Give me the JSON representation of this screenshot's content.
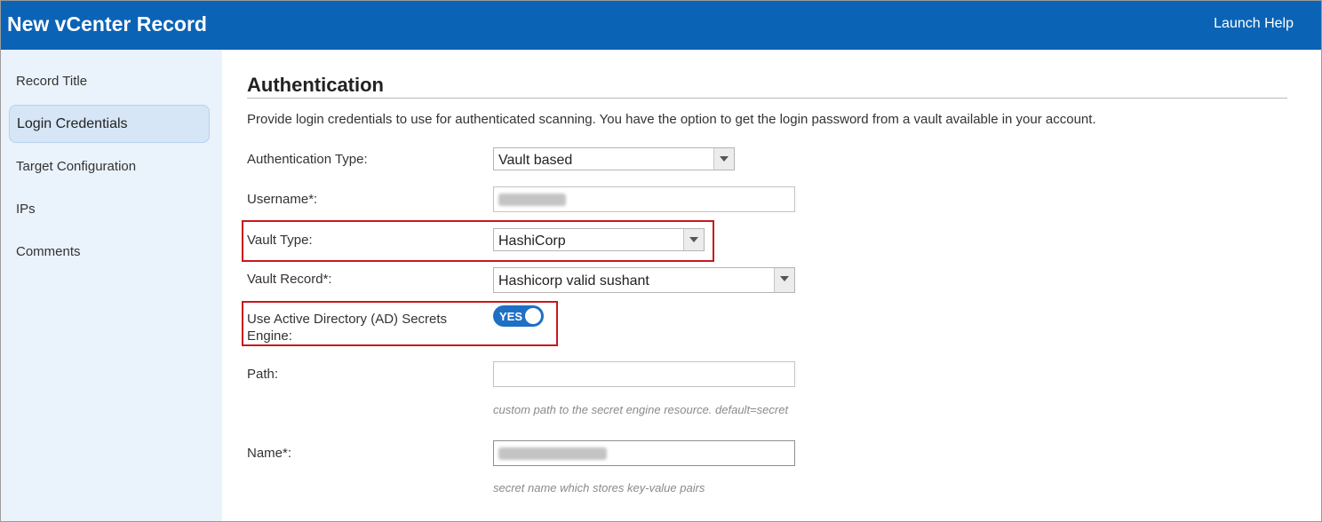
{
  "header": {
    "title": "New vCenter Record",
    "help_label": "Launch Help"
  },
  "sidebar": {
    "items": [
      {
        "label": "Record Title",
        "active": false
      },
      {
        "label": "Login Credentials",
        "active": true
      },
      {
        "label": "Target Configuration",
        "active": false
      },
      {
        "label": "IPs",
        "active": false
      },
      {
        "label": "Comments",
        "active": false
      }
    ]
  },
  "auth": {
    "title": "Authentication",
    "description": "Provide login credentials to use for authenticated scanning. You have the option to get the login password from a vault available in your account.",
    "fields": {
      "auth_type": {
        "label": "Authentication Type:",
        "value": "Vault based"
      },
      "username": {
        "label": "Username*:"
      },
      "vault_type": {
        "label": "Vault Type:",
        "value": "HashiCorp"
      },
      "vault_record": {
        "label": "Vault Record*:",
        "value": "Hashicorp valid sushant"
      },
      "ad_engine": {
        "label": "Use Active Directory (AD) Secrets Engine:",
        "toggle_text": "YES",
        "enabled": true
      },
      "path": {
        "label": "Path:",
        "value": "",
        "hint": "custom path to the secret engine resource. default=secret"
      },
      "name": {
        "label": "Name*:",
        "hint": "secret name which stores key-value pairs"
      }
    }
  },
  "colors": {
    "header": "#0b63b5",
    "sidebar": "#eaf2fb",
    "highlight": "#c9171d",
    "toggle": "#1f6fc5"
  }
}
